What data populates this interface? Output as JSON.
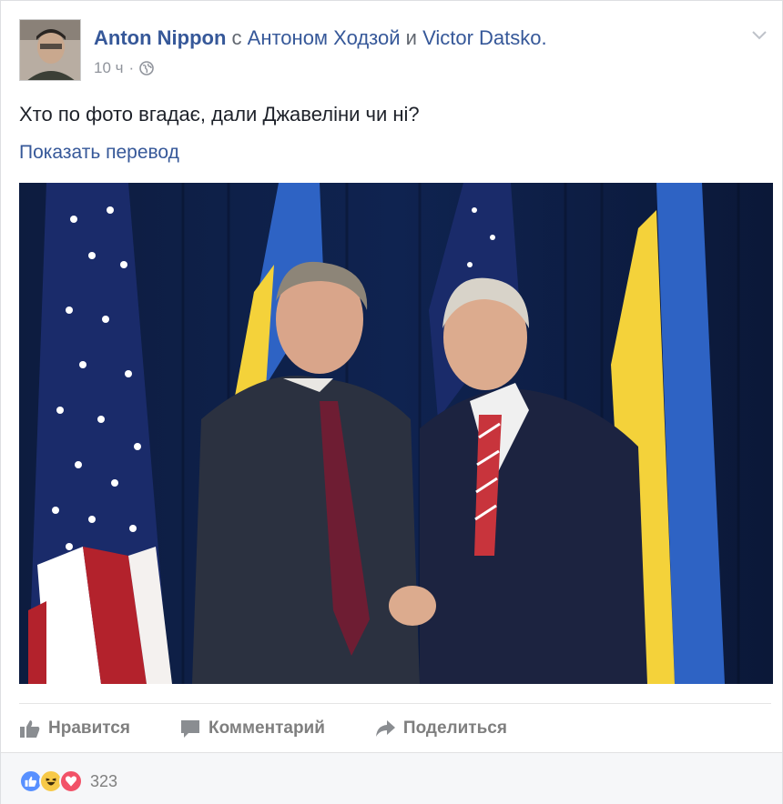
{
  "post": {
    "author": "Anton Nippon",
    "with_word": "с",
    "tag_1": "Антоном Ходзой",
    "and_word": "и",
    "tag_2": "Victor Datsko.",
    "time": "10 ч",
    "time_sep": "·",
    "text": "Хто по фото вгадає, дали Джавеліни чи ні?",
    "translate_link": "Показать перевод"
  },
  "actions": {
    "like": "Нравится",
    "comment": "Комментарий",
    "share": "Поделиться"
  },
  "reactions": {
    "icons": [
      "like-icon",
      "haha-icon",
      "love-icon"
    ],
    "count": "323"
  },
  "colors": {
    "link": "#365899",
    "muted": "#90949c",
    "action": "#7f7f7f",
    "like": "#5890ff",
    "haha": "#f7c948",
    "love": "#f25268"
  }
}
